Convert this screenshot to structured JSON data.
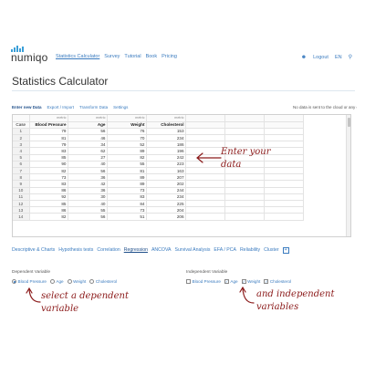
{
  "brand": {
    "logo_text": "numiqo"
  },
  "nav": {
    "links": [
      "Statistics Calculator",
      "Survey",
      "Tutorial",
      "Book",
      "Pricing"
    ],
    "active": 0,
    "right": {
      "logout": "Logout",
      "language": "EN"
    }
  },
  "page_title": "Statistics Calculator",
  "toolbar": {
    "links": [
      "Enter new Data",
      "Export / Import",
      "Transform Data",
      "Settings"
    ],
    "active": 0,
    "note": "No data is sent to the cloud or any other"
  },
  "grid": {
    "meta": [
      "",
      "metric",
      "metric",
      "metric",
      "metric"
    ],
    "headers": [
      "Case",
      "Blood Pressure",
      "Age",
      "Weight",
      "Cholesterol"
    ],
    "rows": [
      [
        "1",
        "79",
        "56",
        "76",
        "153"
      ],
      [
        "2",
        "81",
        "46",
        "70",
        "234"
      ],
      [
        "3",
        "79",
        "34",
        "52",
        "186"
      ],
      [
        "4",
        "83",
        "62",
        "89",
        "196"
      ],
      [
        "5",
        "85",
        "27",
        "82",
        "242"
      ],
      [
        "6",
        "90",
        "40",
        "55",
        "223"
      ],
      [
        "7",
        "82",
        "56",
        "81",
        "163"
      ],
      [
        "8",
        "73",
        "36",
        "89",
        "207"
      ],
      [
        "9",
        "83",
        "42",
        "89",
        "202"
      ],
      [
        "10",
        "86",
        "36",
        "73",
        "244"
      ],
      [
        "11",
        "92",
        "30",
        "83",
        "234"
      ],
      [
        "12",
        "85",
        "40",
        "84",
        "225"
      ],
      [
        "13",
        "86",
        "55",
        "73",
        "204"
      ],
      [
        "14",
        "82",
        "56",
        "51",
        "206"
      ]
    ]
  },
  "annotations": {
    "enter": [
      "Enter your",
      "data"
    ],
    "dependent": [
      "select a dependent",
      "variable"
    ],
    "independent": [
      "and independent",
      "variables"
    ]
  },
  "tabs": {
    "items": [
      "Descriptive & Charts",
      "Hypothesis tests",
      "Correlation",
      "Regression",
      "ANCOVA",
      "Survival Analysis",
      "EFA / PCA",
      "Reliability",
      "Cluster"
    ],
    "active": 3,
    "add_symbol": "+"
  },
  "dependent": {
    "label": "Dependent Variable",
    "options": [
      "Blood Pressure",
      "Age",
      "Weight",
      "Cholesterol"
    ],
    "selected": 0
  },
  "independent": {
    "label": "Independent Variable",
    "options": [
      "Blood Pressure",
      "Age",
      "Weight",
      "Cholesterol"
    ],
    "checked": [
      false,
      true,
      true,
      true
    ]
  },
  "colors": {
    "link": "#3a7bbf",
    "accent": "#3a9fd8",
    "annotation": "#8b1a1a"
  }
}
